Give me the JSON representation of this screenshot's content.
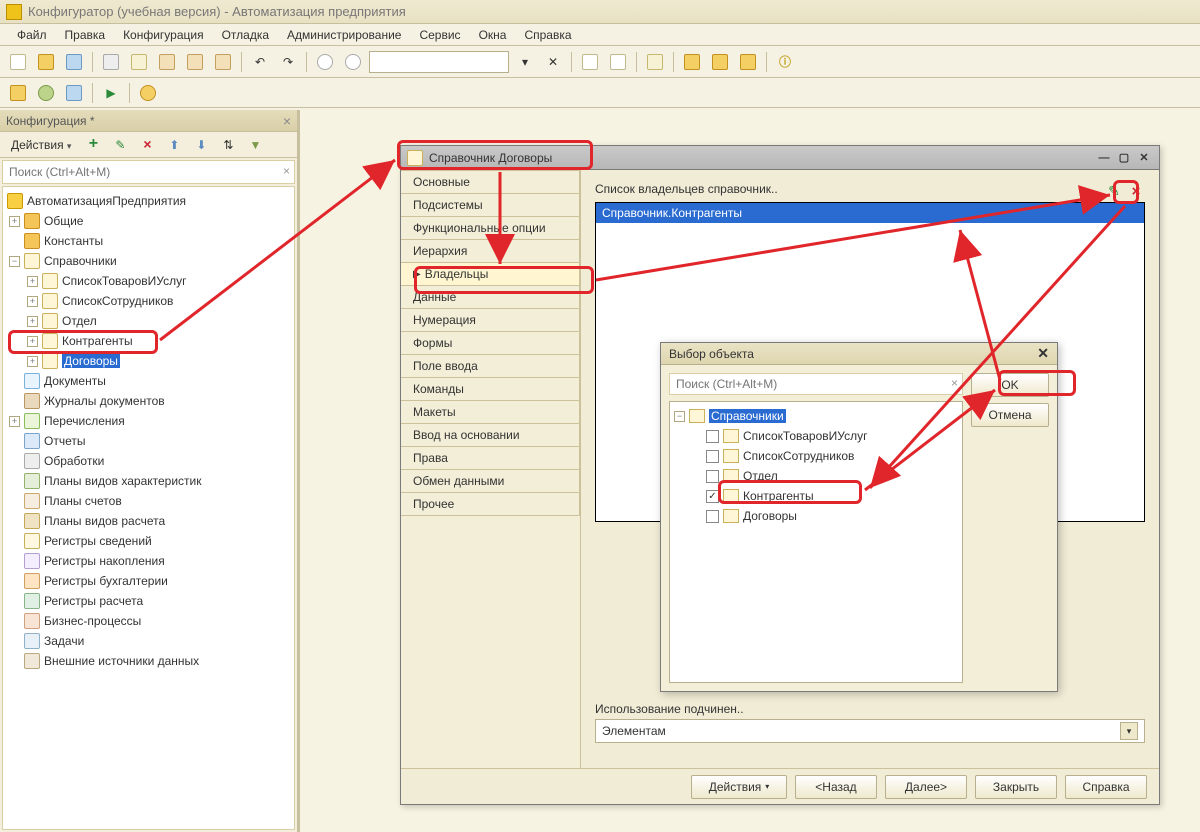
{
  "title": "Конфигуратор (учебная версия) - Автоматизация предприятия",
  "menu": [
    "Файл",
    "Правка",
    "Конфигурация",
    "Отладка",
    "Администрирование",
    "Сервис",
    "Окна",
    "Справка"
  ],
  "panel": {
    "title": "Конфигурация *",
    "actions": "Действия",
    "filter_placeholder": "Поиск (Ctrl+Alt+M)",
    "root": "АвтоматизацияПредприятия",
    "tree": [
      {
        "label": "Общие"
      },
      {
        "label": "Константы"
      },
      {
        "label": "Справочники",
        "children": [
          {
            "label": "СписокТоваровИУслуг"
          },
          {
            "label": "СписокСотрудников"
          },
          {
            "label": "Отдел"
          },
          {
            "label": "Контрагенты"
          },
          {
            "label": "Договоры",
            "selected": true
          }
        ]
      },
      {
        "label": "Документы"
      },
      {
        "label": "Журналы документов"
      },
      {
        "label": "Перечисления"
      },
      {
        "label": "Отчеты"
      },
      {
        "label": "Обработки"
      },
      {
        "label": "Планы видов характеристик"
      },
      {
        "label": "Планы счетов"
      },
      {
        "label": "Планы видов расчета"
      },
      {
        "label": "Регистры сведений"
      },
      {
        "label": "Регистры накопления"
      },
      {
        "label": "Регистры бухгалтерии"
      },
      {
        "label": "Регистры расчета"
      },
      {
        "label": "Бизнес-процессы"
      },
      {
        "label": "Задачи"
      },
      {
        "label": "Внешние источники данных"
      }
    ]
  },
  "cwin": {
    "title": "Справочник Договоры",
    "tabs": [
      "Основные",
      "Подсистемы",
      "Функциональные опции",
      "Иерархия",
      "Владельцы",
      "Данные",
      "Нумерация",
      "Формы",
      "Поле ввода",
      "Команды",
      "Макеты",
      "Ввод на основании",
      "Права",
      "Обмен данными",
      "Прочее"
    ],
    "active_tab": "Владельцы",
    "owners_label": "Список владельцев справочник..",
    "owner_row": "Справочник.Контрагенты",
    "usage_label": "Использование подчинен..",
    "usage_value": "Элементам",
    "footer": {
      "actions": "Действия",
      "back": "<Назад",
      "next": "Далее>",
      "close": "Закрыть",
      "help": "Справка"
    }
  },
  "popup": {
    "title": "Выбор объекта",
    "search_placeholder": "Поиск (Ctrl+Alt+M)",
    "root": "Справочники",
    "items": [
      {
        "label": "СписокТоваровИУслуг",
        "checked": false
      },
      {
        "label": "СписокСотрудников",
        "checked": false
      },
      {
        "label": "Отдел",
        "checked": false
      },
      {
        "label": "Контрагенты",
        "checked": true
      },
      {
        "label": "Договоры",
        "checked": false
      }
    ],
    "ok": "OK",
    "cancel": "Отмена"
  }
}
